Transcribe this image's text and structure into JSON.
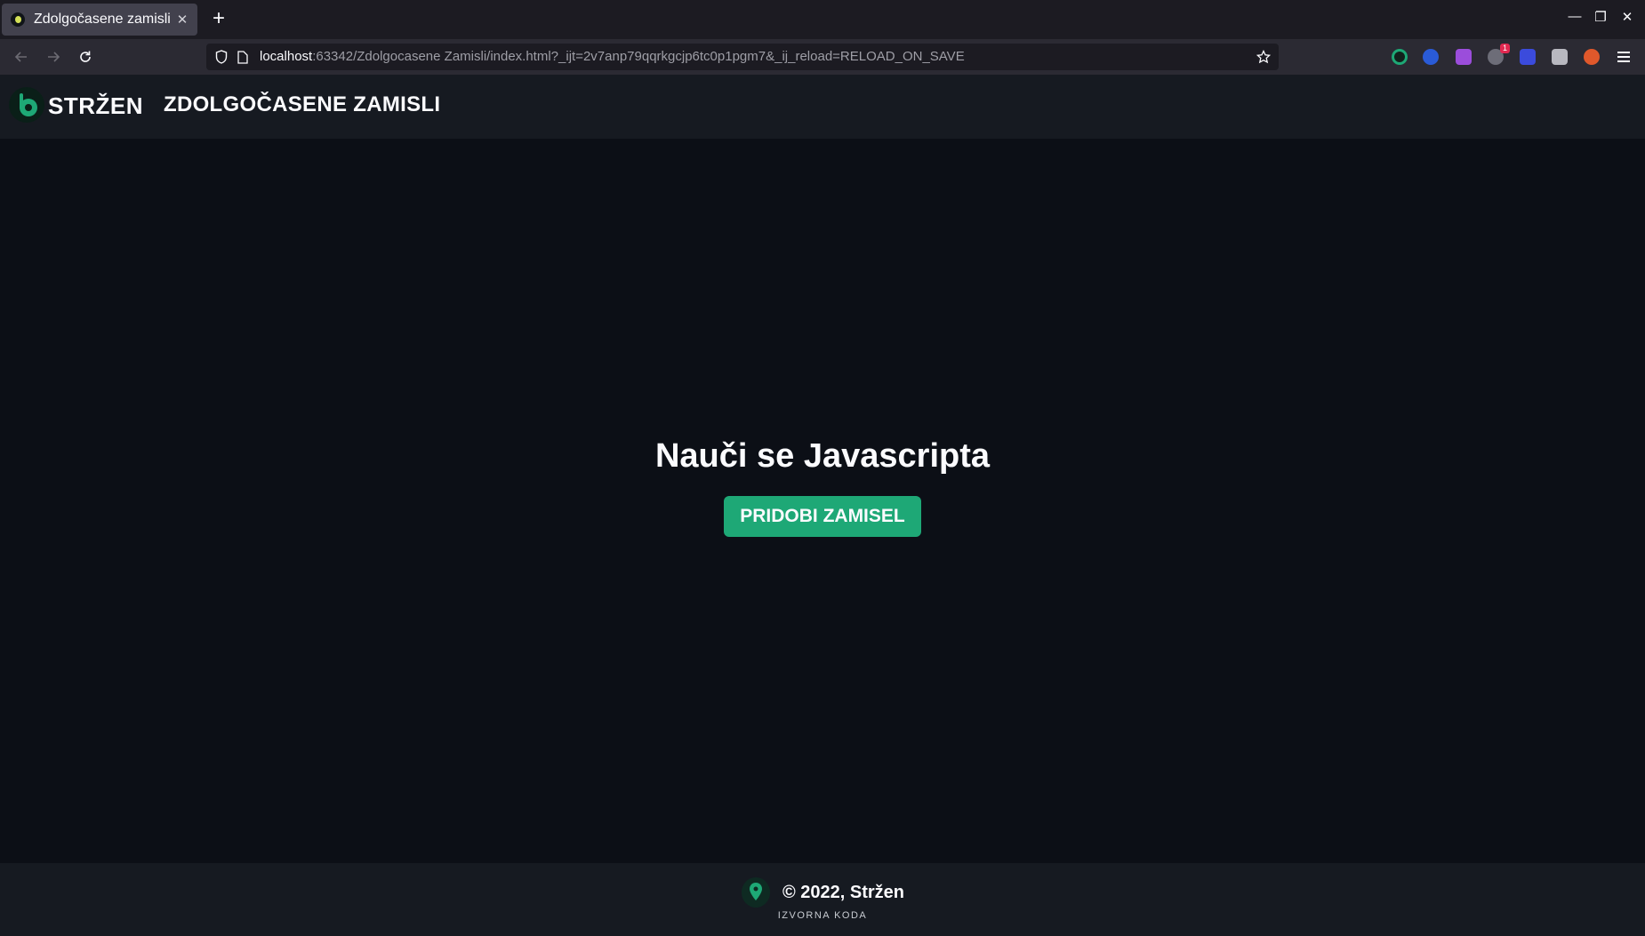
{
  "browser": {
    "tab_title": "Zdolgočasene zamisli",
    "url_host": "localhost",
    "url_rest": ":63342/Zdolgocasene Zamisli/index.html?_ijt=2v7anp79qqrkgcjp6tc0p1pgm7&_ij_reload=RELOAD_ON_SAVE",
    "extension_badge": "1"
  },
  "header": {
    "brand": "STRŽEN",
    "title": "ZDOLGOČASENE ZAMISLI"
  },
  "main": {
    "headline": "Nauči se Javascripta",
    "cta_label": "PRIDOBI ZAMISEL"
  },
  "footer": {
    "copyright": "© 2022, Stržen",
    "source_link": "IZVORNA KODA"
  },
  "colors": {
    "accent": "#1ea876",
    "page_bg": "#0c0f16",
    "header_bg": "#161a21"
  }
}
